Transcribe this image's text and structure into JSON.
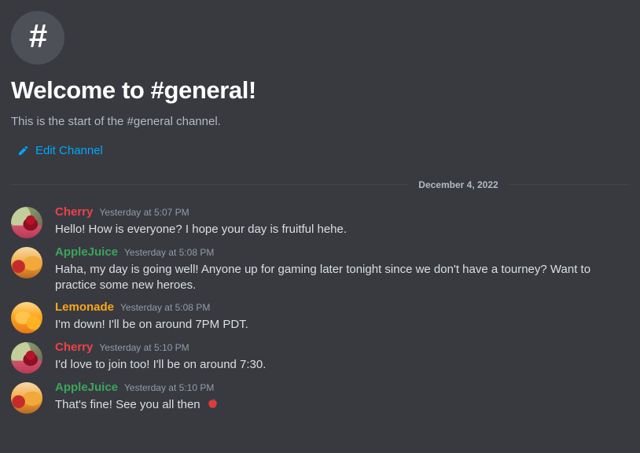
{
  "colors": {
    "background": "#383a40",
    "link_blue": "#00a8fc",
    "text_primary": "#dbdee1",
    "text_muted": "#b5bac1",
    "timestamp": "#949ba4",
    "divider": "#43454b",
    "hash_circle": "#4e5058"
  },
  "intro": {
    "hash_icon": "hash-icon",
    "hash_glyph": "#",
    "title": "Welcome to #general!",
    "subtitle": "This is the start of the #general channel.",
    "edit_channel_label": "Edit Channel",
    "edit_channel_icon": "pencil-icon"
  },
  "divider": {
    "date": "December 4, 2022"
  },
  "messages": [
    {
      "author": "Cherry",
      "author_color": "#ed4245",
      "timestamp": "Yesterday at 5:07 PM",
      "text": "Hello! How is everyone? I hope your day is fruitful hehe.",
      "avatar": "cherry-drink-avatar",
      "avatar_class": "av-cherry",
      "emoji": ""
    },
    {
      "author": "AppleJuice",
      "author_color": "#3ba55c",
      "timestamp": "Yesterday at 5:08 PM",
      "text": "Haha, my day is going well! Anyone up for gaming later tonight since we don't have a tourney? Want to practice some new heroes.",
      "avatar": "apple-juice-avatar",
      "avatar_class": "av-apple",
      "emoji": ""
    },
    {
      "author": "Lemonade",
      "author_color": "#faa61a",
      "timestamp": "Yesterday at 5:08 PM",
      "text": "I'm down! I'll be on around 7PM PDT.",
      "avatar": "lemonade-avatar",
      "avatar_class": "av-lemonade",
      "emoji": ""
    },
    {
      "author": "Cherry",
      "author_color": "#ed4245",
      "timestamp": "Yesterday at 5:10 PM",
      "text": "I'd love to join too! I'll be on around 7:30.",
      "avatar": "cherry-drink-avatar",
      "avatar_class": "av-cherry",
      "emoji": ""
    },
    {
      "author": "AppleJuice",
      "author_color": "#3ba55c",
      "timestamp": "Yesterday at 5:10 PM",
      "text": "That's fine! See you all then ",
      "avatar": "apple-juice-avatar",
      "avatar_class": "av-apple",
      "emoji": "red-apple-emoji"
    }
  ]
}
